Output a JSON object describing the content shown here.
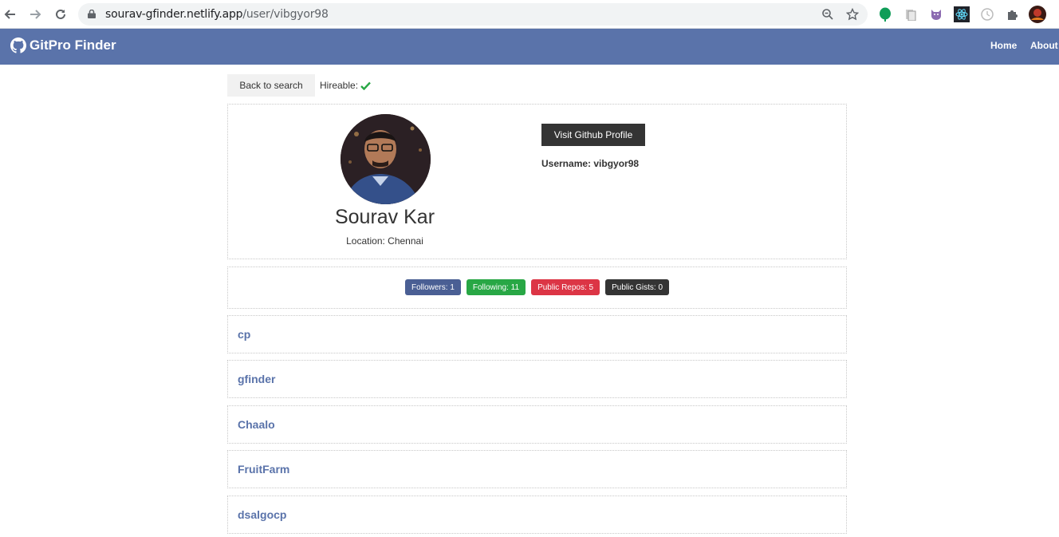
{
  "browser": {
    "url_host": "sourav-gfinder.netlify.app",
    "url_path": "/user/vibgyor98"
  },
  "navbar": {
    "brand": "GitPro Finder",
    "links": [
      "Home",
      "About"
    ],
    "color": "#5a73aa"
  },
  "toolbar": {
    "back_label": "Back to search",
    "hireable_label": "Hireable:",
    "hireable": true
  },
  "profile": {
    "name": "Sourav Kar",
    "location": "Location: Chennai",
    "visit_label": "Visit Github Profile",
    "username": "Username: vibgyor98"
  },
  "stats": [
    {
      "label": "Followers: 1",
      "color": "#4a5f94"
    },
    {
      "label": "Following: 11",
      "color": "#28a745"
    },
    {
      "label": "Public Repos: 5",
      "color": "#dc3545"
    },
    {
      "label": "Public Gists: 0",
      "color": "#343434"
    }
  ],
  "repos": [
    "cp",
    "gfinder",
    "Chaalo",
    "FruitFarm",
    "dsalgocp"
  ]
}
